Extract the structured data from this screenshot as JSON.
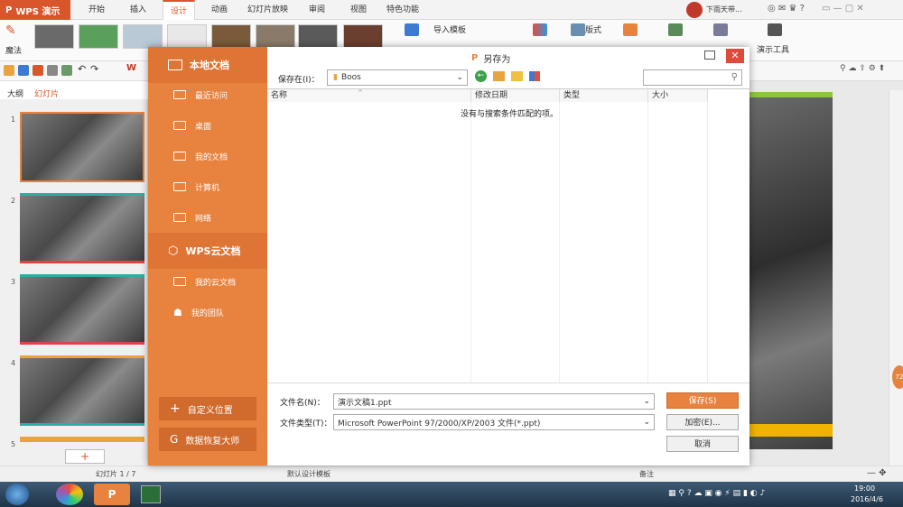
{
  "app": {
    "logo_text": "WPS 演示",
    "tabs": [
      "开始",
      "插入",
      "设计",
      "动画",
      "幻灯片放映",
      "审阅",
      "视图",
      "特色功能"
    ],
    "active_tab": "设计",
    "user_name": "下雨天带...",
    "magic_label": "魔法",
    "ribbon_right": [
      "导入模板",
      "版式",
      "演示工具"
    ],
    "quick_tabs": [
      "大纲",
      "幻灯片"
    ]
  },
  "slides": {
    "numbers": [
      "1",
      "2",
      "3",
      "4",
      "5"
    ],
    "add_button": "+"
  },
  "status": {
    "slide_info": "幻灯片 1 / 7",
    "template": "默认设计模板",
    "notes": "备注",
    "zoom_value": "72"
  },
  "taskbar": {
    "time": "19:00",
    "date": "2016/4/6"
  },
  "dialog": {
    "title": "另存为",
    "close_icon": "close-icon",
    "sidebar": {
      "local_header": "本地文档",
      "local_items": [
        "最近访问",
        "桌面",
        "我的文档",
        "计算机",
        "网络"
      ],
      "cloud_header": "WPS云文档",
      "cloud_items": [
        "我的云文档",
        "我的团队"
      ],
      "custom_location_button": "自定义位置",
      "recovery_button": "数据恢复大师"
    },
    "save_in_label": "保存在(I)：",
    "save_in_value": "Boos",
    "columns": [
      "名称",
      "修改日期",
      "类型",
      "大小"
    ],
    "empty_message": "没有与搜索条件匹配的项。",
    "filename_label": "文件名(N)：",
    "filename_value": "演示文稿1.ppt",
    "filetype_label": "文件类型(T)：",
    "filetype_value": "Microsoft PowerPoint 97/2000/XP/2003 文件(*.ppt)",
    "save_button": "保存(S)",
    "encrypt_button": "加密(E)...",
    "cancel_button": "取消"
  },
  "colors": {
    "accent": "#d9552b",
    "sidebar": "#e8823f",
    "save_button": "#e8823f"
  }
}
